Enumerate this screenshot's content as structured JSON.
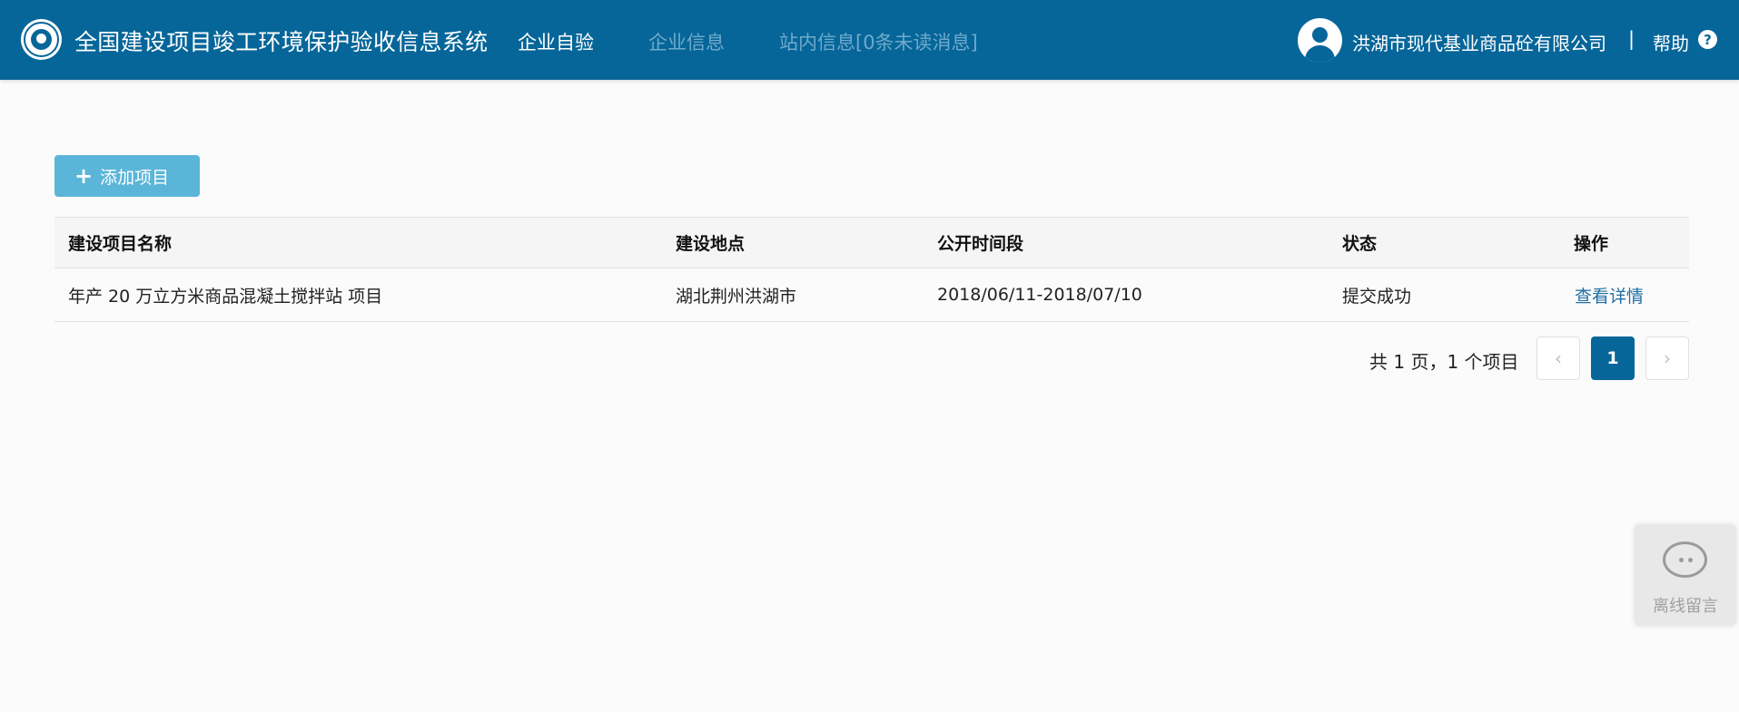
{
  "header": {
    "system_title": "全国建设项目竣工环境保护验收信息系统",
    "nav": [
      {
        "label": "企业自验"
      },
      {
        "label": "企业信息"
      },
      {
        "label": "站内信息[0条未读消息]"
      }
    ],
    "company_name": "洪湖市现代基业商品砼有限公司",
    "separator": "|",
    "help_label": "帮助",
    "help_icon_glyph": "?"
  },
  "toolbar": {
    "add_icon_glyph": "+",
    "add_label": "添加项目"
  },
  "table": {
    "columns": [
      "建设项目名称",
      "建设地点",
      "公开时间段",
      "状态",
      "操作"
    ],
    "rows": [
      {
        "name": "年产 20 万立方米商品混凝土搅拌站 项目",
        "location": "湖北荆州洪湖市",
        "period": "2018/06/11-2018/07/10",
        "status": "提交成功",
        "action": "查看详情"
      }
    ]
  },
  "pagination": {
    "summary": "共 1 页，1 个项目",
    "prev_glyph": "‹",
    "current_page": "1",
    "next_glyph": "›"
  },
  "chat_widget": {
    "label": "离线留言"
  },
  "colors": {
    "brand": "#066699",
    "add_button": "#5bb5d9",
    "link": "#1f6fa4"
  }
}
